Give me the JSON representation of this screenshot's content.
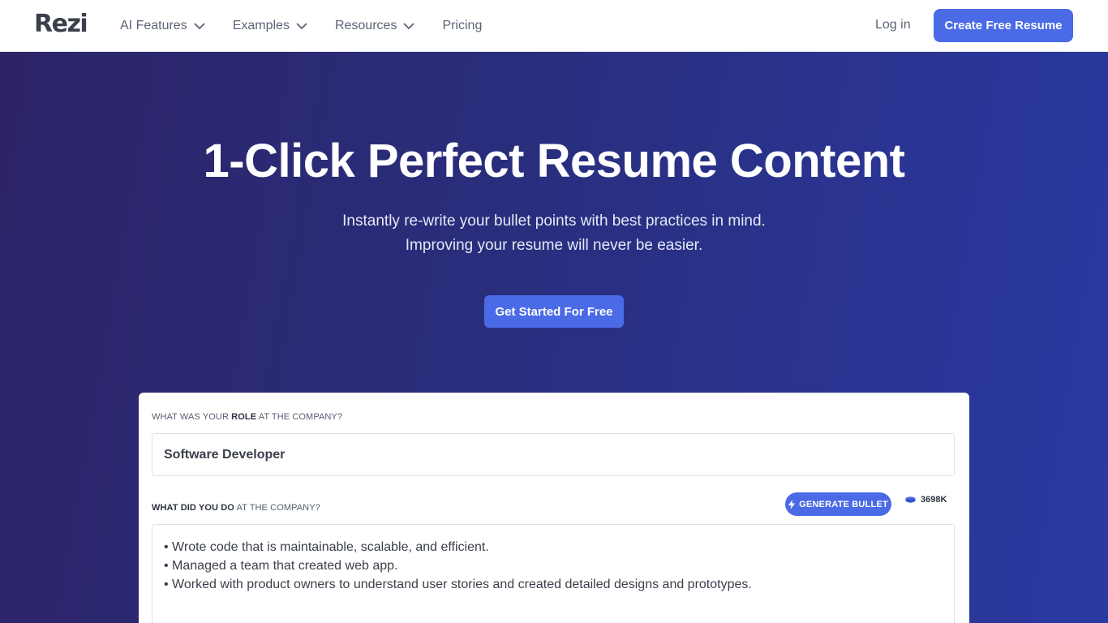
{
  "brand": {
    "logo": "Rezi"
  },
  "nav": {
    "items": [
      {
        "label": "AI Features",
        "has_dropdown": true
      },
      {
        "label": "Examples",
        "has_dropdown": true
      },
      {
        "label": "Resources",
        "has_dropdown": true
      },
      {
        "label": "Pricing",
        "has_dropdown": false
      }
    ],
    "login": "Log in",
    "cta": "Create Free Resume"
  },
  "hero": {
    "title": "1-Click Perfect Resume Content",
    "subtitle_line1": "Instantly re-write your bullet points with best practices in mind.",
    "subtitle_line2": "Improving your resume will never be easier.",
    "cta": "Get Started For Free"
  },
  "form": {
    "role_question": {
      "prefix": "WHAT WAS YOUR",
      "emphasis": "ROLE",
      "suffix": "AT THE COMPANY?"
    },
    "role_value": "Software Developer",
    "tasks_question": {
      "emphasis": "WHAT DID YOU DO",
      "suffix": "AT THE COMPANY?"
    },
    "generate_label": "GENERATE BULLET",
    "token_count": "3698K",
    "bullets": [
      "• Wrote code that is maintainable, scalable, and efficient.",
      "• Managed a team that created web app.",
      "• Worked with product owners to understand user stories and created detailed designs and prototypes."
    ]
  },
  "colors": {
    "accent": "#4a6ae6",
    "hero_start": "#2d2467",
    "hero_end": "#2a3aa3",
    "nav_text": "#5b6475"
  },
  "icons": {
    "chevron": "chevron-down-icon",
    "bolt": "lightning-icon",
    "token": "coin-stack-icon"
  }
}
